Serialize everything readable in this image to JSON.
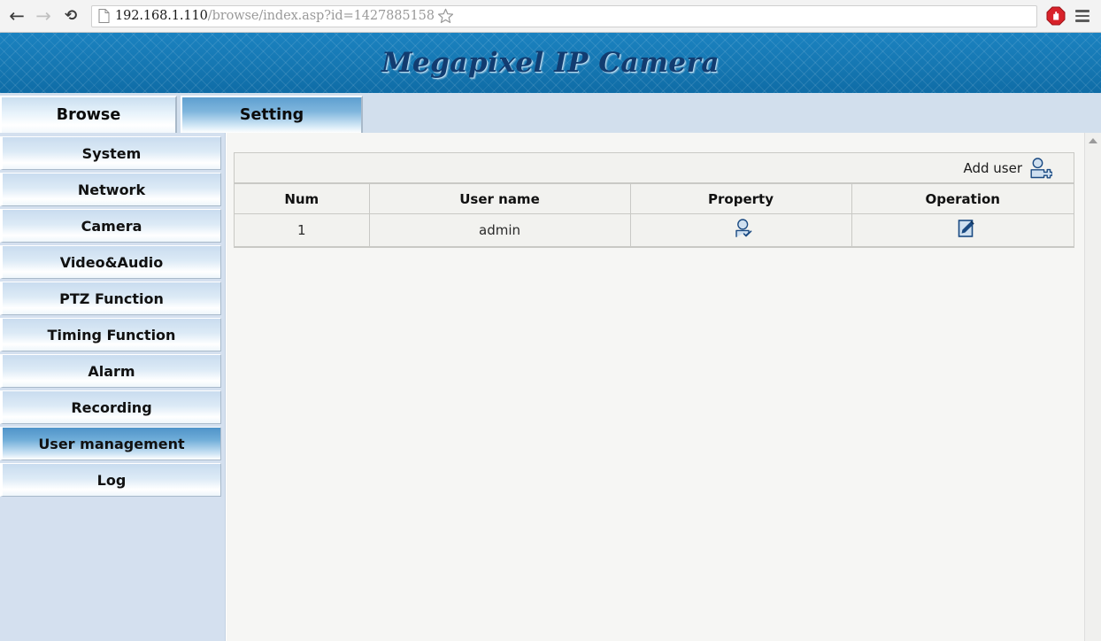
{
  "browser": {
    "back_icon": "back-arrow-icon",
    "forward_icon": "forward-arrow-icon",
    "reload_icon": "reload-icon",
    "page_icon": "page-document-icon",
    "url_host": "192.168.1.110",
    "url_path": "/browse/index.asp?id=1427885158",
    "star_icon": "bookmark-star-icon",
    "adblock_icon": "adblock-stop-icon",
    "menu_icon": "hamburger-menu-icon"
  },
  "banner": {
    "title": "Megapixel IP Camera",
    "bg_color": "#1778b4",
    "title_color": "#123c70"
  },
  "tabs": [
    {
      "label": "Browse",
      "active": false
    },
    {
      "label": "Setting",
      "active": true
    }
  ],
  "sidebar": {
    "items": [
      {
        "label": "System",
        "active": false
      },
      {
        "label": "Network",
        "active": false
      },
      {
        "label": "Camera",
        "active": false
      },
      {
        "label": "Video&Audio",
        "active": false
      },
      {
        "label": "PTZ Function",
        "active": false
      },
      {
        "label": "Timing Function",
        "active": false
      },
      {
        "label": "Alarm",
        "active": false
      },
      {
        "label": "Recording",
        "active": false
      },
      {
        "label": "User management",
        "active": true
      },
      {
        "label": "Log",
        "active": false
      }
    ],
    "bg_color": "#d4e0ef",
    "active_color": "#4f93c9"
  },
  "main": {
    "add_user": {
      "label": "Add user",
      "icon": "add-user-icon"
    },
    "table": {
      "columns": [
        "Num",
        "User name",
        "Property",
        "Operation"
      ],
      "rows": [
        {
          "num": "1",
          "user_name": "admin",
          "property_icon": "user-property-icon",
          "operation_icon": "edit-pencil-icon"
        }
      ]
    }
  },
  "scrollbar": {
    "up_arrow_icon": "scroll-up-arrow-icon"
  }
}
